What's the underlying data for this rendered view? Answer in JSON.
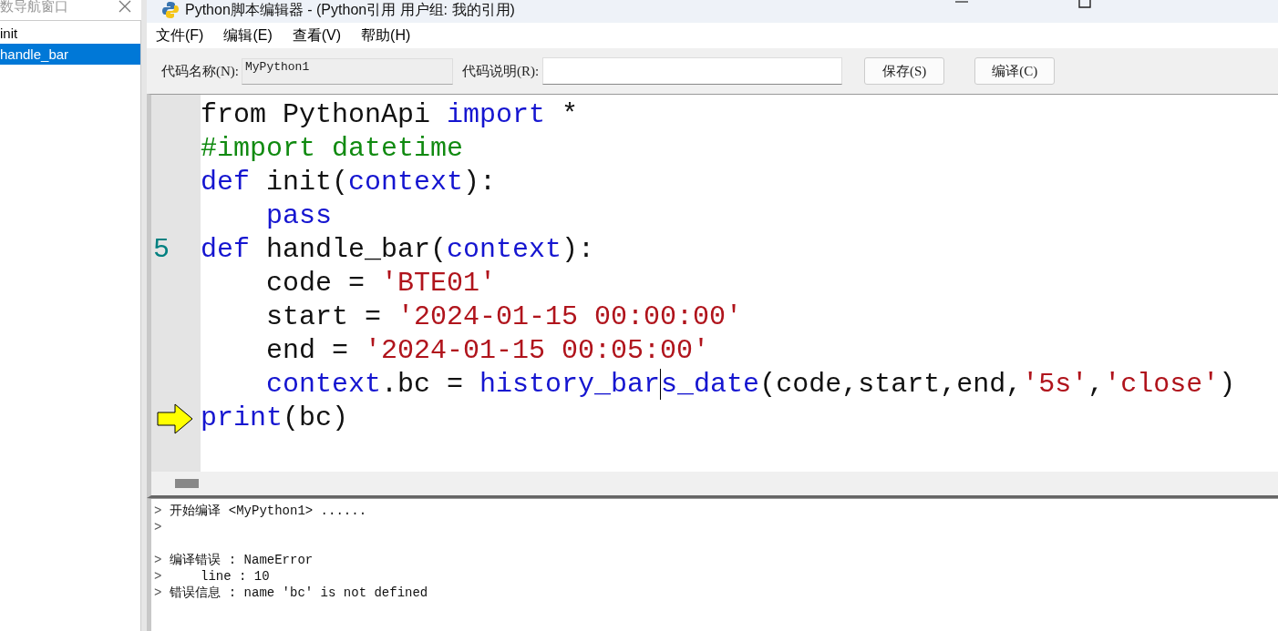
{
  "navigator": {
    "title": "数导航窗口",
    "items": [
      {
        "label": "init",
        "selected": false
      },
      {
        "label": "handle_bar",
        "selected": true
      }
    ]
  },
  "window": {
    "title": "Python脚本编辑器 - (Python引用 用户组: 我的引用)"
  },
  "menu": [
    "文件(F)",
    "编辑(E)",
    "查看(V)",
    "帮助(H)"
  ],
  "toolbar": {
    "name_label": "代码名称(N):",
    "name_value": "MyPython1",
    "desc_label": "代码说明(R):",
    "buttons": [
      "保存(S)",
      "编译(C)"
    ]
  },
  "editor": {
    "lines": [
      {
        "tokens": [
          {
            "kind": "plain",
            "text": "from PythonApi "
          },
          {
            "kind": "keyword",
            "text": "import"
          },
          {
            "kind": "plain",
            "text": " *"
          }
        ]
      },
      {
        "tokens": [
          {
            "kind": "comment",
            "text": "#import datetime"
          }
        ]
      },
      {
        "tokens": [
          {
            "kind": "keyword",
            "text": "def"
          },
          {
            "kind": "plain",
            "text": " init("
          },
          {
            "kind": "keyword",
            "text": "context"
          },
          {
            "kind": "plain",
            "text": "):"
          }
        ]
      },
      {
        "indented": true,
        "tokens": [
          {
            "kind": "keyword",
            "text": "pass"
          }
        ]
      },
      {
        "number": "5",
        "tokens": [
          {
            "kind": "keyword",
            "text": "def"
          },
          {
            "kind": "plain",
            "text": " handle_bar("
          },
          {
            "kind": "keyword",
            "text": "context"
          },
          {
            "kind": "plain",
            "text": "):"
          }
        ]
      },
      {
        "tokens": [
          {
            "kind": "plain",
            "text": "    code = "
          },
          {
            "kind": "string",
            "text": "'BTE01'"
          }
        ]
      },
      {
        "tokens": [
          {
            "kind": "plain",
            "text": "    start = "
          },
          {
            "kind": "string",
            "text": "'2024-01-15 00:00:00'"
          }
        ]
      },
      {
        "tokens": [
          {
            "kind": "plain",
            "text": "    end = "
          },
          {
            "kind": "string",
            "text": "'2024-01-15 00:05:00'"
          }
        ]
      },
      {
        "indented": true,
        "tokens": [
          {
            "kind": "keyword",
            "text": "context"
          },
          {
            "kind": "plain",
            "text": ".bc = "
          },
          {
            "kind": "keyword",
            "text": "history_bar",
            "caret": true
          },
          {
            "kind": "keyword",
            "text": "s_date"
          },
          {
            "kind": "plain",
            "text": "(code,start,end,"
          },
          {
            "kind": "string",
            "text": "'5s'"
          },
          {
            "kind": "plain",
            "text": ","
          },
          {
            "kind": "string",
            "text": "'close'"
          },
          {
            "kind": "plain",
            "text": ")"
          }
        ]
      },
      {
        "current": true,
        "tokens": [
          {
            "kind": "keyword",
            "text": "print"
          },
          {
            "kind": "plain",
            "text": "(bc)"
          }
        ]
      }
    ]
  },
  "output": [
    {
      "prompt": ">",
      "text": "开始编译 <MyPython1> ......"
    },
    {
      "prompt": ">"
    },
    {
      "prompt": ">",
      "text": "编译错误 : NameError",
      "gap_before": true
    },
    {
      "prompt": ">",
      "text": "    line : 10"
    },
    {
      "prompt": ">",
      "text": "错误信息 : name 'bc' is not defined"
    }
  ]
}
